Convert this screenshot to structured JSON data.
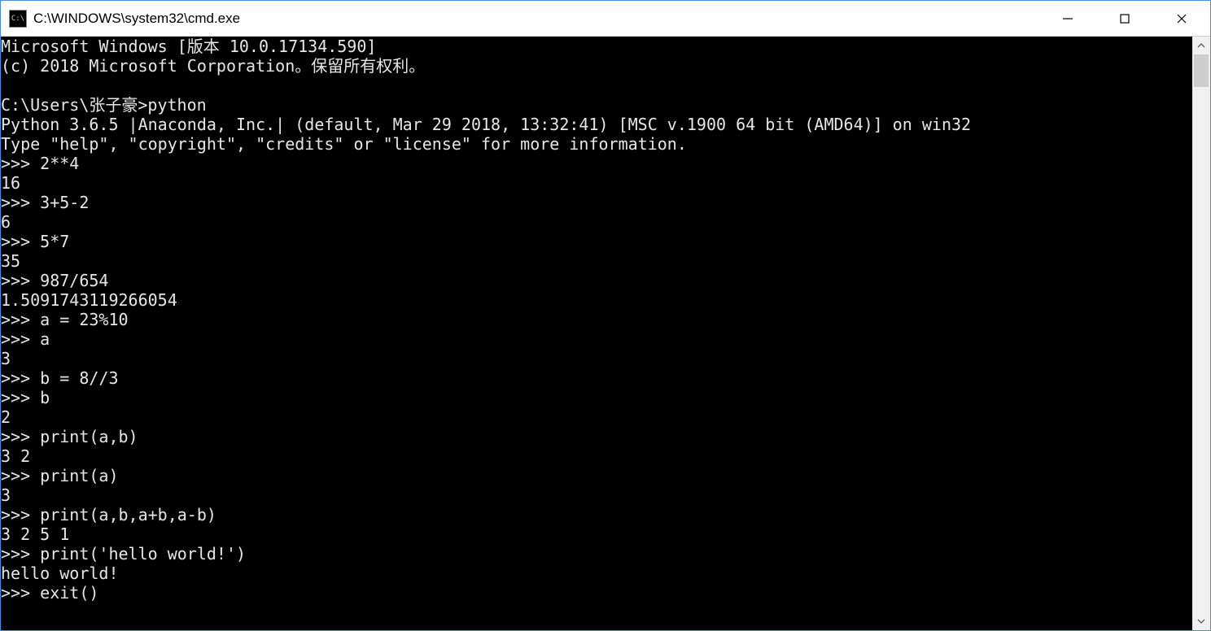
{
  "window": {
    "title": "C:\\WINDOWS\\system32\\cmd.exe",
    "icon_label": "C:\\"
  },
  "terminal": {
    "lines": [
      "Microsoft Windows [版本 10.0.17134.590]",
      "(c) 2018 Microsoft Corporation。保留所有权利。",
      "",
      "C:\\Users\\张子豪>python",
      "Python 3.6.5 |Anaconda, Inc.| (default, Mar 29 2018, 13:32:41) [MSC v.1900 64 bit (AMD64)] on win32",
      "Type \"help\", \"copyright\", \"credits\" or \"license\" for more information.",
      ">>> 2**4",
      "16",
      ">>> 3+5-2",
      "6",
      ">>> 5*7",
      "35",
      ">>> 987/654",
      "1.5091743119266054",
      ">>> a = 23%10",
      ">>> a",
      "3",
      ">>> b = 8//3",
      ">>> b",
      "2",
      ">>> print(a,b)",
      "3 2",
      ">>> print(a)",
      "3",
      ">>> print(a,b,a+b,a-b)",
      "3 2 5 1",
      ">>> print('hello world!')",
      "hello world!",
      ">>> exit()"
    ]
  }
}
